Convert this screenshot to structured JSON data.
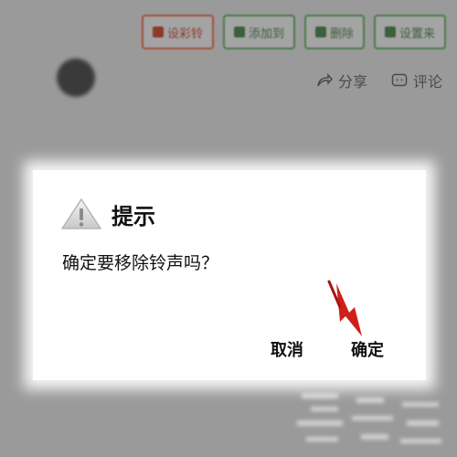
{
  "toolbar": {
    "buttons": [
      {
        "label": "设彩铃",
        "icon": "bell-icon"
      },
      {
        "label": "添加到",
        "icon": "plus-square-icon"
      },
      {
        "label": "删除",
        "icon": "trash-icon"
      },
      {
        "label": "设置来",
        "icon": "phone-icon"
      }
    ]
  },
  "post": {
    "author": "",
    "title": ""
  },
  "actions": {
    "share_label": "分享",
    "comment_label": "评论"
  },
  "dialog": {
    "title": "提示",
    "message": "确定要移除铃声吗？",
    "cancel_label": "取消",
    "confirm_label": "确定",
    "icon": "warning-icon"
  },
  "colors": {
    "dim_overlay": "#9a9a9a",
    "toolbar_green": "#4a7a4a",
    "toolbar_red": "#a0503a",
    "arrow_red": "#d0201a"
  }
}
